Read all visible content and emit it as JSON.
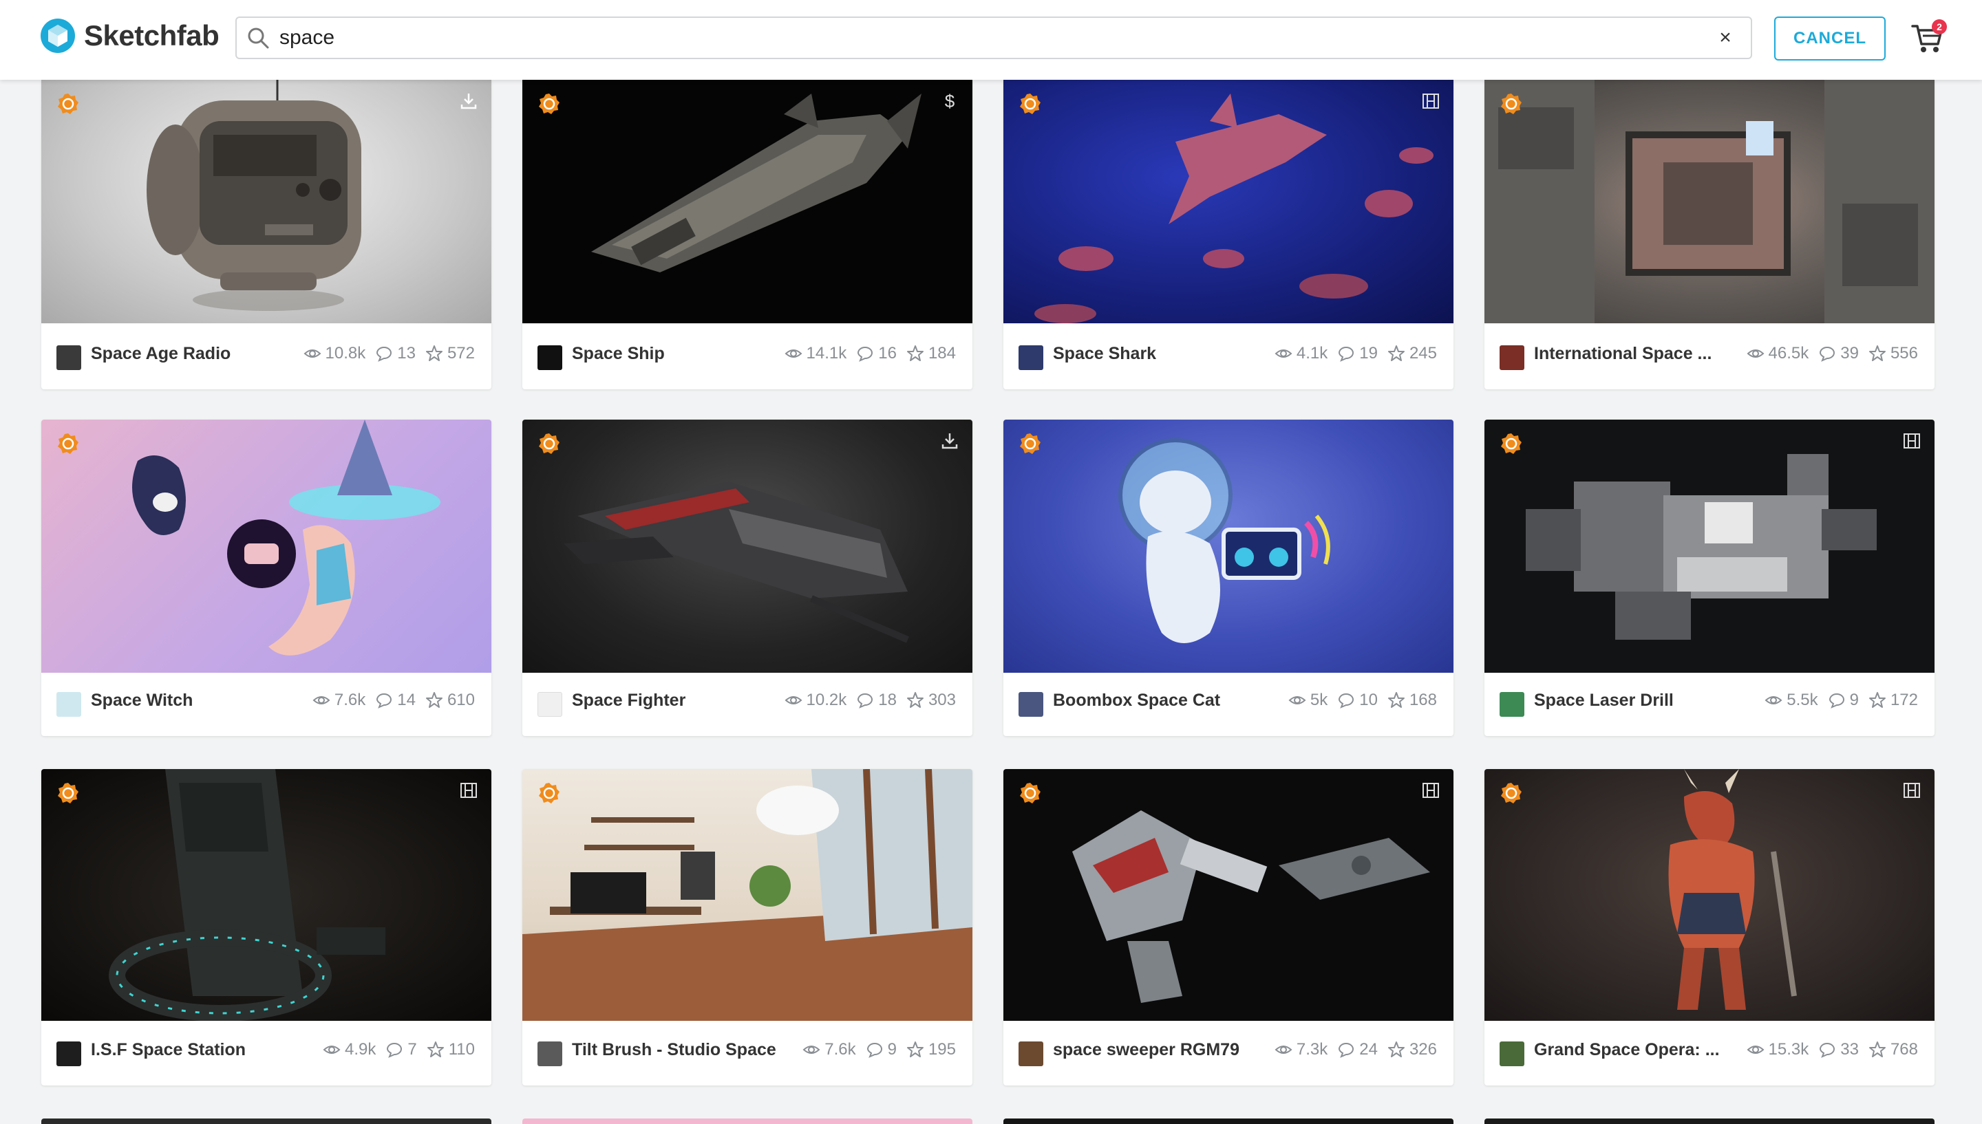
{
  "header": {
    "brand": "Sketchfab",
    "search_value": "space",
    "cancel_label": "CANCEL",
    "cart_badge": "2"
  },
  "colors": {
    "accent": "#1caad9",
    "staff_badge": "#f08c1c",
    "cart_badge": "#e8344e"
  },
  "icons": [
    "logo-icon",
    "search-icon",
    "close-icon",
    "cart-icon",
    "staff-pick-icon",
    "download-icon",
    "dollar-icon",
    "animated-icon",
    "eye-icon",
    "comment-icon",
    "star-icon"
  ],
  "cards": [
    {
      "title": "Space Age Radio",
      "views": "10.8k",
      "comments": "13",
      "likes": "572",
      "corner": "download"
    },
    {
      "title": "Space Ship",
      "views": "14.1k",
      "comments": "16",
      "likes": "184",
      "corner": "dollar",
      "corner_text": "$"
    },
    {
      "title": "Space Shark",
      "views": "4.1k",
      "comments": "19",
      "likes": "245",
      "corner": "animated"
    },
    {
      "title": "International Space ...",
      "views": "46.5k",
      "comments": "39",
      "likes": "556",
      "corner": "none"
    },
    {
      "title": "Space Witch",
      "views": "7.6k",
      "comments": "14",
      "likes": "610",
      "corner": "none"
    },
    {
      "title": "Space Fighter",
      "views": "10.2k",
      "comments": "18",
      "likes": "303",
      "corner": "download"
    },
    {
      "title": "Boombox Space Cat",
      "views": "5k",
      "comments": "10",
      "likes": "168",
      "corner": "none"
    },
    {
      "title": "Space Laser Drill",
      "views": "5.5k",
      "comments": "9",
      "likes": "172",
      "corner": "animated"
    },
    {
      "title": "I.S.F Space Station",
      "views": "4.9k",
      "comments": "7",
      "likes": "110",
      "corner": "animated"
    },
    {
      "title": "Tilt Brush - Studio Space",
      "views": "7.6k",
      "comments": "9",
      "likes": "195",
      "corner": "none"
    },
    {
      "title": "space sweeper RGM79",
      "views": "7.3k",
      "comments": "24",
      "likes": "326",
      "corner": "animated"
    },
    {
      "title": "Grand Space Opera: ...",
      "views": "15.3k",
      "comments": "33",
      "likes": "768",
      "corner": "animated"
    }
  ]
}
